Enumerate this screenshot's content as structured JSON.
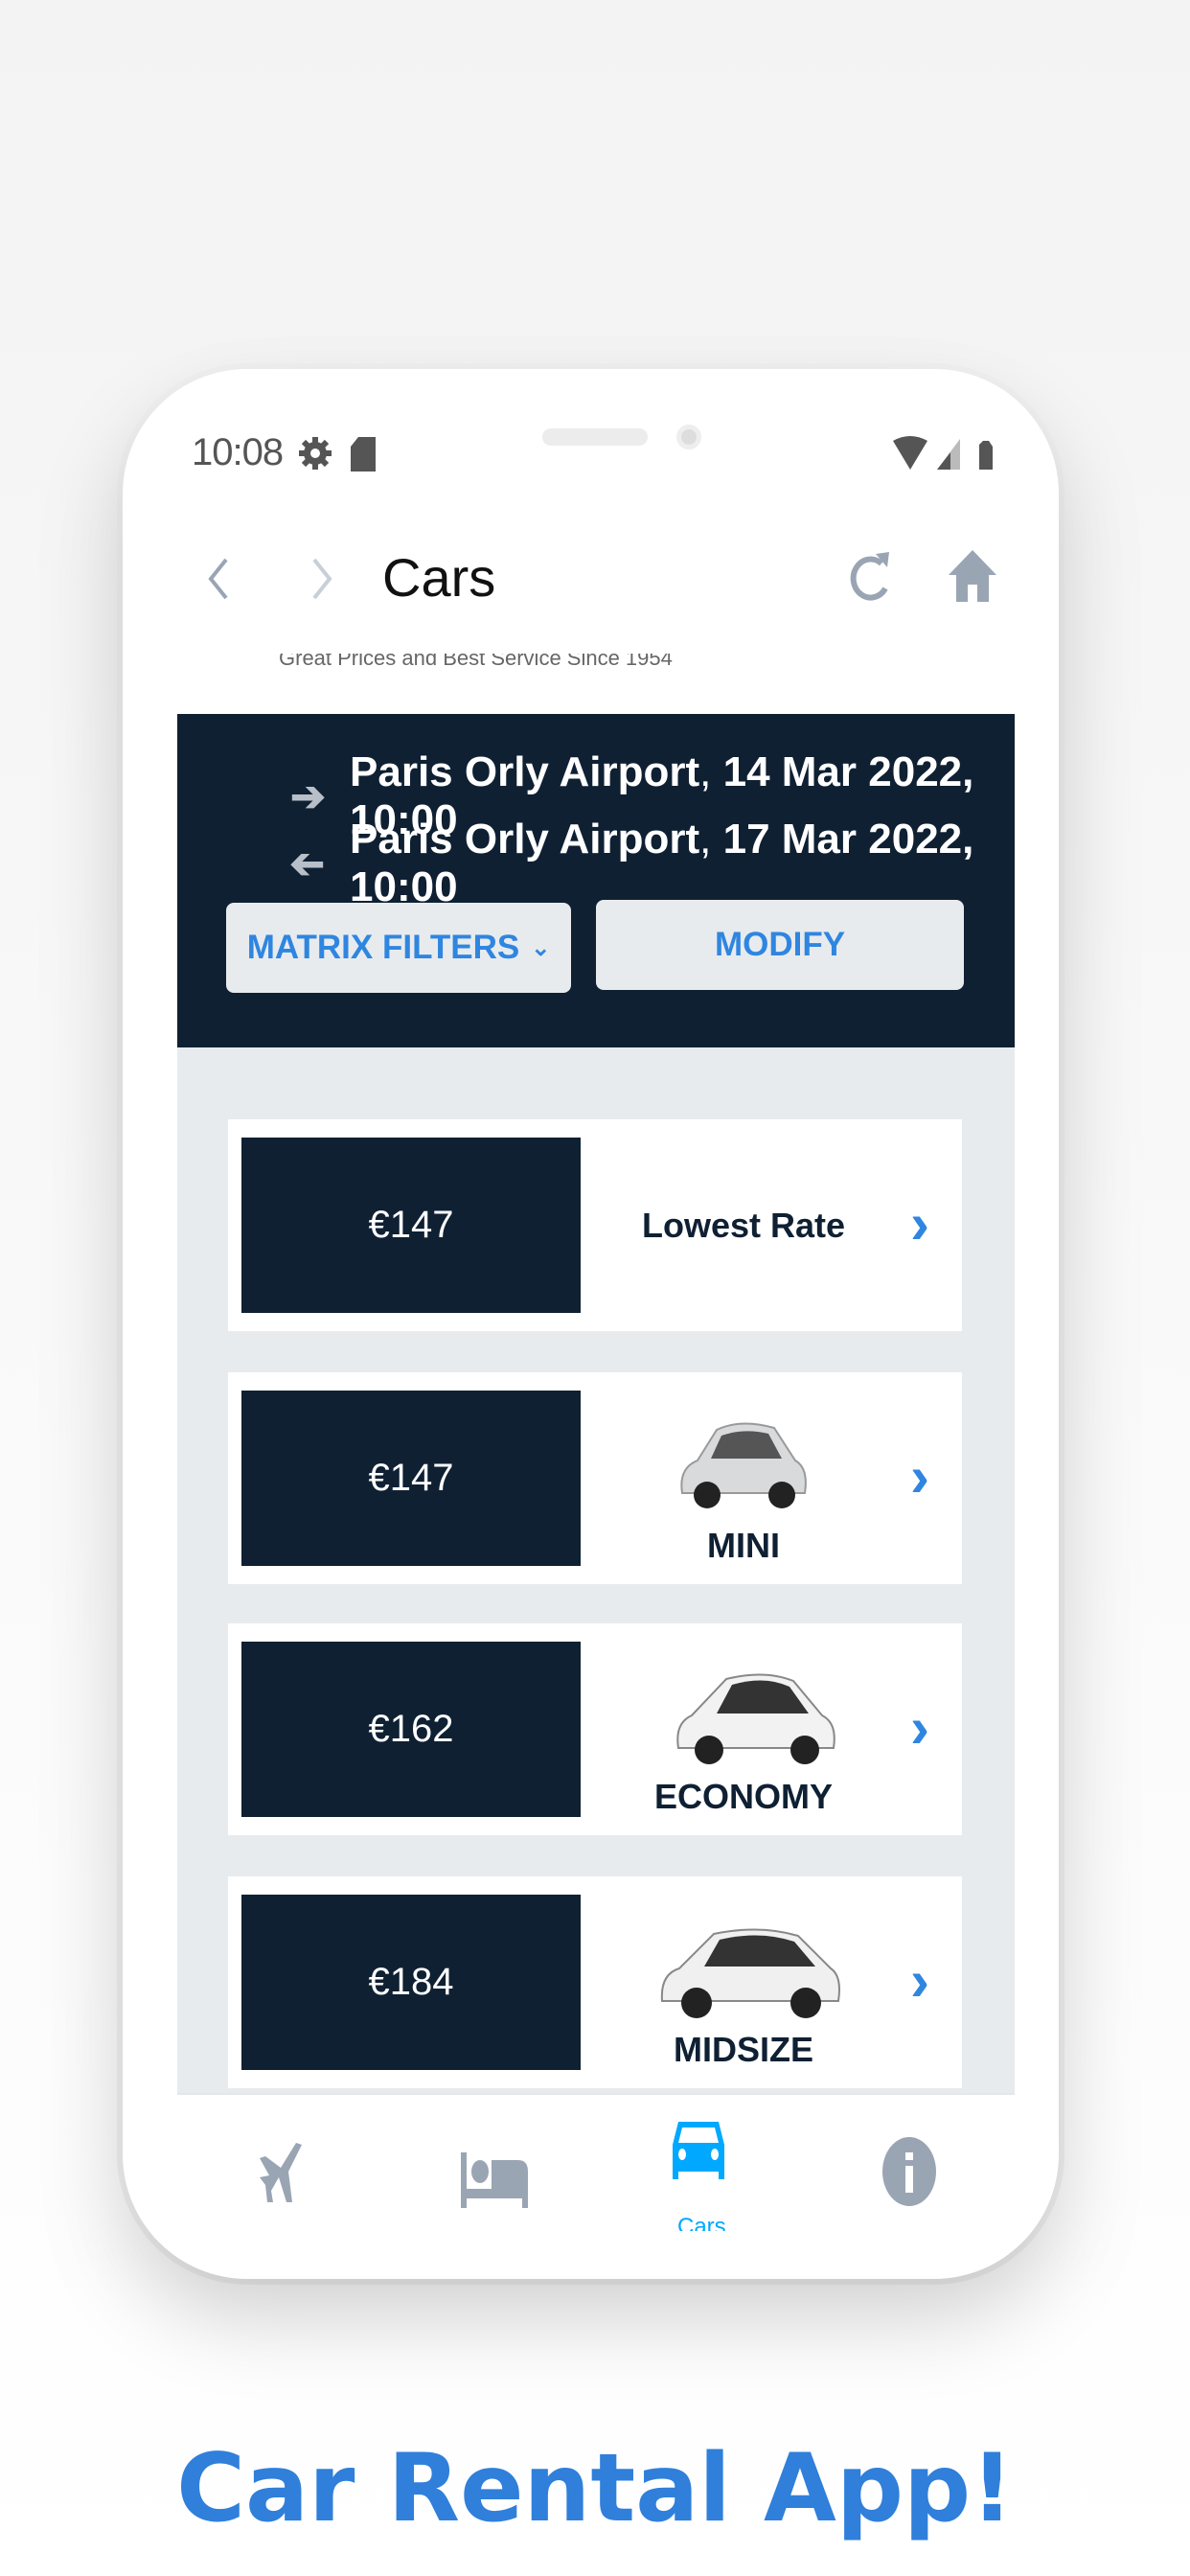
{
  "status_bar": {
    "time": "10:08",
    "icons": [
      "gear-icon",
      "sd-card-icon",
      "wifi-icon",
      "signal-icon",
      "battery-icon"
    ]
  },
  "nav": {
    "title": "Cars",
    "back_icon": "chevron-left-icon",
    "forward_icon": "chevron-right-icon",
    "refresh_icon": "refresh-icon",
    "home_icon": "home-icon"
  },
  "subtitle": "Great Prices and Best Service Since 1954",
  "search": {
    "pickup": {
      "location": "Paris Orly Airport",
      "details": "14 Mar 2022, 10:00"
    },
    "dropoff": {
      "location": "Paris Orly Airport",
      "details": "17 Mar 2022, 10:00"
    },
    "matrix_filters_label": "MATRIX FILTERS",
    "modify_label": "MODIFY"
  },
  "results": [
    {
      "price": "€147",
      "label": "Lowest Rate"
    },
    {
      "price": "€147",
      "label": "MINI"
    },
    {
      "price": "€162",
      "label": "ECONOMY"
    },
    {
      "price": "€184",
      "label": "MIDSIZE"
    }
  ],
  "tabs": [
    {
      "icon": "airplane-icon"
    },
    {
      "icon": "bed-icon"
    },
    {
      "icon": "car-icon",
      "label": "Cars",
      "active": true
    },
    {
      "icon": "info-icon"
    }
  ],
  "tagline": "Car Rental App!",
  "colors": {
    "navy": "#0f2033",
    "accent": "#2f86e0",
    "active_tab": "#00a8ff",
    "inactive": "#9aa5b4"
  }
}
